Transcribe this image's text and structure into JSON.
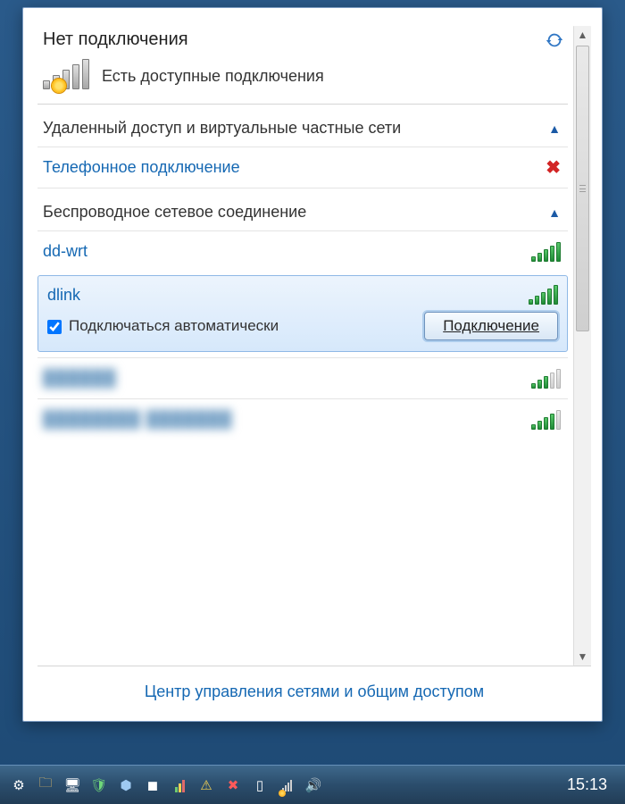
{
  "header": {
    "title": "Нет подключения",
    "status_text": "Есть доступные подключения"
  },
  "sections": {
    "dialup": {
      "title": "Удаленный доступ и виртуальные частные сети",
      "item_label": "Телефонное подключение"
    },
    "wifi": {
      "title": "Беспроводное сетевое соединение"
    }
  },
  "networks": [
    {
      "name": "dd-wrt",
      "strength": 5
    },
    {
      "name": "dlink",
      "strength": 5,
      "selected": true
    }
  ],
  "selected": {
    "auto_label": "Подключаться автоматически",
    "auto_checked": true,
    "connect_label": "Подключение"
  },
  "blurred": [
    {
      "placeholder": "██████",
      "strength": 3
    },
    {
      "placeholder": "████████ ███████",
      "strength": 4
    }
  ],
  "footer": {
    "link_label": "Центр управления сетями и общим доступом"
  },
  "taskbar": {
    "clock": "15:13"
  }
}
